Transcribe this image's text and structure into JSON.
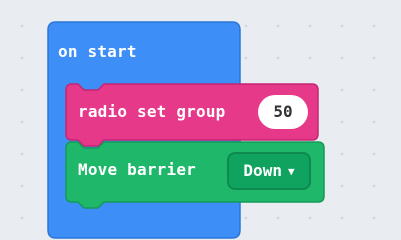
{
  "workspace": {
    "on_start": {
      "label": "on start",
      "color": "#3d8ef7"
    },
    "radio_block": {
      "label": "radio set group",
      "value": "50",
      "color": "#e6398a"
    },
    "barrier_block": {
      "label": "Move barrier",
      "dropdown_value": "Down",
      "caret": "▼",
      "color": "#1fb86b"
    }
  }
}
